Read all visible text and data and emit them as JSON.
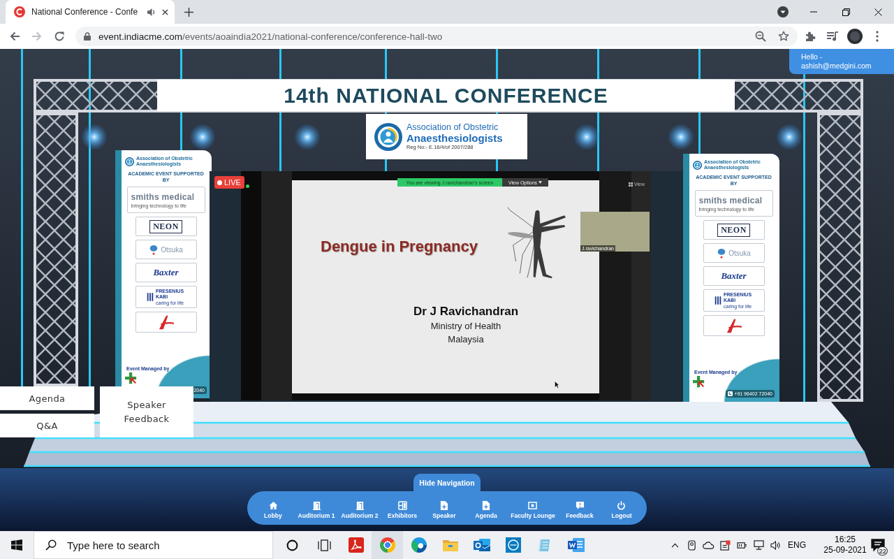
{
  "browser": {
    "tab_title": "National Conference - Confe",
    "forward": {
      "disabled": true
    },
    "url": {
      "host": "event.indiacme.com",
      "path": "/events/aoaindia2021/national-conference/conference-hall-two"
    }
  },
  "user_badge": {
    "greeting": "Hello -",
    "email": "ashish@medgini.com"
  },
  "title_banner": "14th NATIONAL CONFERENCE",
  "logo_banner": {
    "line_1": "Association of Obstetric",
    "line_2": "Anaesthesiologists",
    "reg_no": "Reg No:- E.16/4/of 2007/288"
  },
  "side_banners": [
    {
      "org": "Association of Obstetric Anaesthesiologists",
      "heading": "ACADEMIC EVENT SUPPORTED BY",
      "sponsors": [
        {
          "kind": "wordmark",
          "name": "smiths medical",
          "tagline": "bringing technology to life"
        },
        {
          "kind": "boxed",
          "name": "NEON"
        },
        {
          "kind": "bubble",
          "name": "Otsuka"
        },
        {
          "kind": "italic",
          "name": "Baxter"
        },
        {
          "kind": "stripes",
          "name": "FRESENIUS KABI",
          "tagline": "caring for life"
        },
        {
          "kind": "mark"
        }
      ],
      "managed_by": "Event Managed by",
      "phone_icon": false,
      "phone": "2040"
    },
    {
      "org": "Association of Obstetric Anaesthesiologists",
      "heading": "ACADEMIC EVENT SUPPORTED BY",
      "sponsors": [
        {
          "kind": "wordmark",
          "name": "smiths medical",
          "tagline": "bringing technology to life"
        },
        {
          "kind": "boxed",
          "name": "NEON"
        },
        {
          "kind": "bubble",
          "name": "Otsuka"
        },
        {
          "kind": "italic",
          "name": "Baxter"
        },
        {
          "kind": "stripes",
          "name": "FRESENIUS KABI",
          "tagline": "caring for life"
        },
        {
          "kind": "mark"
        }
      ],
      "managed_by": "Event Managed by",
      "phone_icon": true,
      "phone": "+91 96402 72040"
    }
  ],
  "stream": {
    "live": "LIVE",
    "share_notice": "You are viewing J.ravichandran's screen",
    "view_options": "View Options",
    "view": "View",
    "participant": "J.ravichandran",
    "slide": {
      "title": "Dengue in Pregnancy",
      "speaker": "Dr J Ravichandran",
      "lines": [
        "Ministry of Health",
        "Malaysia"
      ]
    }
  },
  "side_buttons": [
    {
      "label": "Agenda"
    },
    {
      "label": "Q&A"
    },
    {
      "label": "Speaker Feedback"
    }
  ],
  "navigation": {
    "toggle": "Hide Navigation",
    "items": [
      {
        "kind": "home",
        "label": "Lobby"
      },
      {
        "kind": "door",
        "label": "Auditorium 1"
      },
      {
        "kind": "door",
        "label": "Auditorium 2"
      },
      {
        "kind": "grid",
        "label": "Exhibitors"
      },
      {
        "kind": "document",
        "label": "Speaker"
      },
      {
        "kind": "document",
        "label": "Agenda"
      },
      {
        "kind": "screen",
        "label": "Faculty Lounge"
      },
      {
        "kind": "chat",
        "label": "Feedback"
      },
      {
        "kind": "power",
        "label": "Logout"
      }
    ]
  },
  "taskbar": {
    "search_placeholder": "Type here to search",
    "language": "ENG",
    "time": "16:25",
    "date": "25-09-2021",
    "notifications": "22"
  }
}
